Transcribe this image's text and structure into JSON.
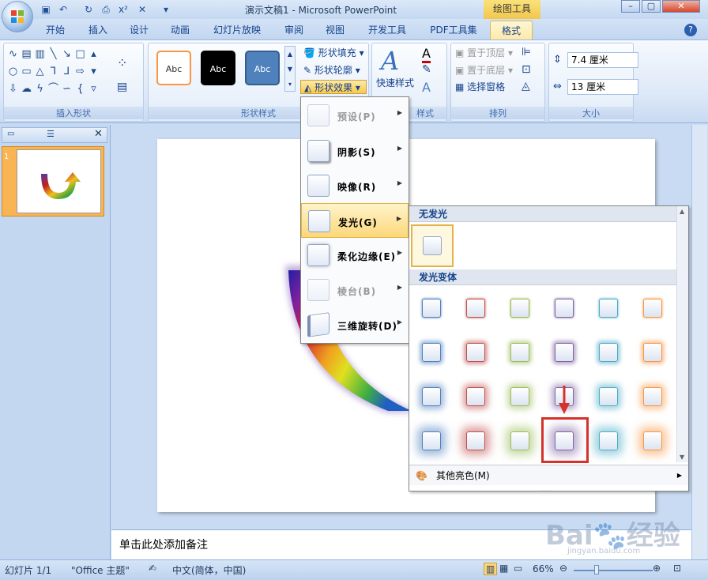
{
  "window": {
    "title": "演示文稿1 - Microsoft PowerPoint",
    "context_tab": "绘图工具"
  },
  "tabs": [
    "开始",
    "插入",
    "设计",
    "动画",
    "幻灯片放映",
    "审阅",
    "视图",
    "开发工具",
    "PDF工具集",
    "格式"
  ],
  "ribbon": {
    "groups": {
      "insert_shapes": "插入形状",
      "shape_styles": "形状样式",
      "wordart": "样式",
      "arrange": "排列",
      "size": "大小"
    },
    "style_samples": [
      "Abc",
      "Abc",
      "Abc"
    ],
    "shape_fill": "形状填充",
    "shape_outline": "形状轮廓",
    "shape_effects": "形状效果",
    "quick_styles": "快速样式",
    "bring_front": "置于顶层",
    "send_back": "置于底层",
    "selection_pane": "选择窗格",
    "height": "7.4 厘米",
    "width": "13 厘米"
  },
  "effects_menu": [
    {
      "label": "预设(P)",
      "enabled": false
    },
    {
      "label": "阴影(S)",
      "enabled": true
    },
    {
      "label": "映像(R)",
      "enabled": true
    },
    {
      "label": "发光(G)",
      "enabled": true,
      "highlighted": true
    },
    {
      "label": "柔化边缘(E)",
      "enabled": true
    },
    {
      "label": "棱台(B)",
      "enabled": false
    },
    {
      "label": "三维旋转(D)",
      "enabled": true
    }
  ],
  "glow_gallery": {
    "no_glow_header": "无发光",
    "variants_header": "发光变体",
    "more_colors": "其他亮色(M)",
    "colors": [
      "#4f81bd",
      "#c0504d",
      "#9bbb59",
      "#8064a2",
      "#4bacc6",
      "#f79646"
    ]
  },
  "notes_placeholder": "单击此处添加备注",
  "status": {
    "slide": "幻灯片 1/1",
    "theme": "\"Office 主题\"",
    "language": "中文(简体，中国)",
    "zoom": "66%"
  },
  "watermark": {
    "brand": "Bai 经验",
    "url": "jingyan.baidu.com"
  }
}
